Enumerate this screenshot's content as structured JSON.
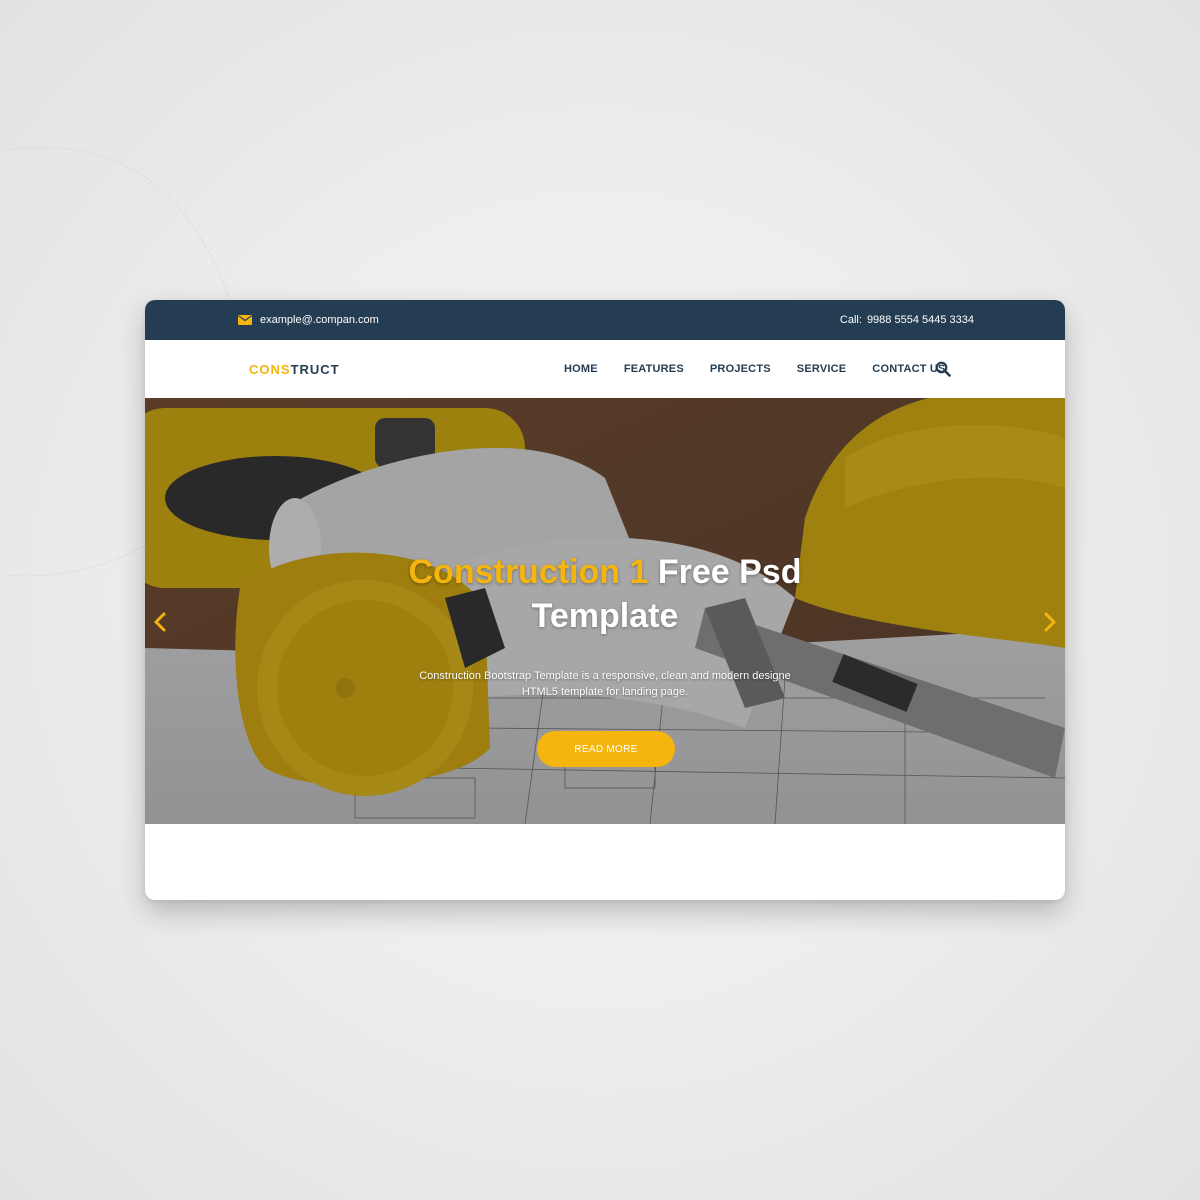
{
  "topbar": {
    "email": "example@.compan.com",
    "call_label": "Call:",
    "phone": "9988 5554 5445 3334"
  },
  "brand": {
    "logo_part1": "CONS",
    "logo_part2": "TRUCT",
    "accent_color": "#f5b40e",
    "dark_color": "#253d52"
  },
  "nav": {
    "items": [
      {
        "label": "HOME"
      },
      {
        "label": "FEATURES"
      },
      {
        "label": "PROJECTS"
      },
      {
        "label": "SERVICE"
      },
      {
        "label": "CONTACT US"
      }
    ],
    "search_icon": "search-icon"
  },
  "hero": {
    "title_highlight": "Construction 1",
    "title_rest": "Free Psd",
    "title_line2": "Template",
    "description": "Construction Bootstrap Template is a responsive, clean and modern designe HTML5 template for landing page.",
    "button_label": "READ MORE",
    "prev_icon": "chevron-left-icon",
    "next_icon": "chevron-right-icon"
  }
}
